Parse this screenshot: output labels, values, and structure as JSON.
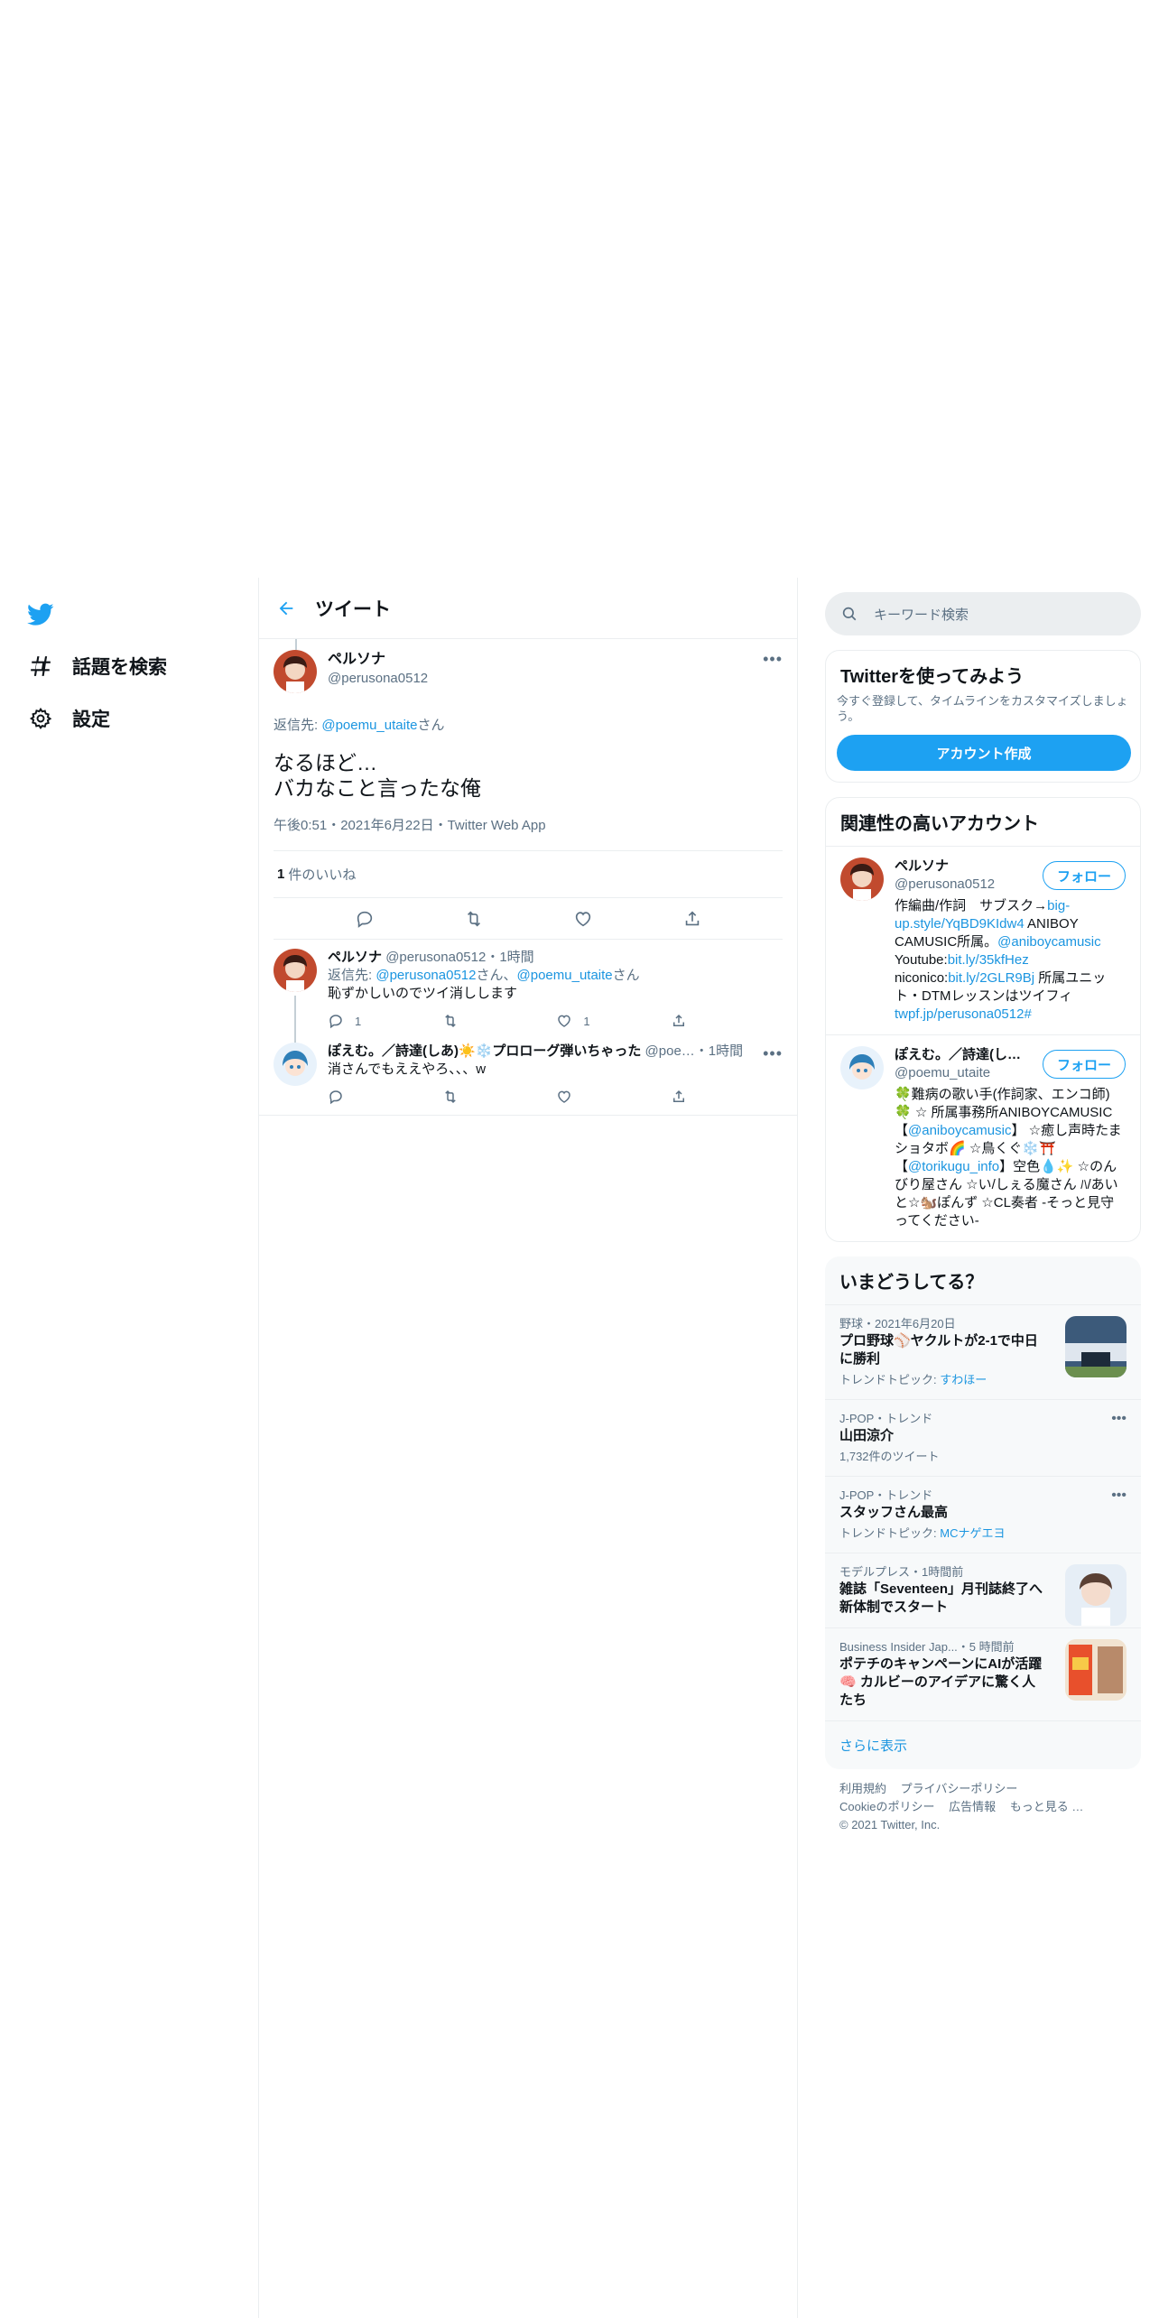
{
  "nav": {
    "items": [
      {
        "label": "話題を検索",
        "icon": "hashtag-icon"
      },
      {
        "label": "設定",
        "icon": "gear-icon"
      }
    ]
  },
  "header": {
    "title": "ツイート"
  },
  "main_tweet": {
    "name": "ペルソナ",
    "handle": "@perusona0512",
    "reply_prefix": "返信先: ",
    "reply_to": "@poemu_utaite",
    "reply_suffix": "さん",
    "text_line1": "なるほど…",
    "text_line2": "バカなこと言ったな俺",
    "meta": "午後0:51・2021年6月22日・Twitter Web App",
    "likes_count": "1",
    "likes_label": "件のいいね"
  },
  "replies": [
    {
      "name": "ペルソナ",
      "handle": "@perusona0512",
      "time": "・1時間",
      "reply_prefix": "返信先: ",
      "reply_to1": "@perusona0512",
      "reply_mid": "さん、",
      "reply_to2": "@poemu_utaite",
      "reply_suffix": "さん",
      "text": "恥ずかしいのでツイ消しします",
      "reply_count": "1",
      "retweet_count": "",
      "like_count": "1"
    },
    {
      "name": "ぽえむ。／詩達(しあ)☀️❄️プロローグ弾いちゃった",
      "handle": "@poe…",
      "time": "・1時間",
      "text": "消さんでもええやろ、、、w",
      "reply_count": "",
      "retweet_count": "",
      "like_count": ""
    }
  ],
  "search": {
    "placeholder": "キーワード検索"
  },
  "signup": {
    "title": "Twitterを使ってみよう",
    "desc": "今すぐ登録して、タイムラインをカスタマイズしましょう。",
    "button": "アカウント作成"
  },
  "related": {
    "title": "関連性の高いアカウント",
    "follow_label": "フォロー",
    "accounts": [
      {
        "name": "ペルソナ",
        "handle": "@perusona0512",
        "bio_1": "作編曲/作詞　サブスク→",
        "bio_link1": "big-up.style/YqBD9KIdw4",
        "bio_2": " ANIBOY CAMUSIC所属。",
        "bio_link2": "@aniboycamusic",
        "bio_3": " Youtube:",
        "bio_link3": "bit.ly/35kfHez",
        "bio_4": " niconico:",
        "bio_link4": "bit.ly/2GLR9Bj",
        "bio_5": " 所属ユニット・DTMレッスンはツイフィ ",
        "bio_link5": "twpf.jp/perusona0512#"
      },
      {
        "name": "ぽえむ。／詩達(しあ)☀️❄️",
        "handle": "@poemu_utaite",
        "bio_1": "🍀難病の歌い手(作詞家、エンコ師)🍀 ☆ 所属事務所ANIBOYCAMUSIC【",
        "bio_link1": "@aniboycamusic",
        "bio_2": "】 ☆癒し声時たまショタボ🌈 ☆鳥くぐ❄️⛩️【",
        "bio_link2": "@torikugu_info",
        "bio_3": "】空色💧✨ ☆のんびり屋さん ☆い/しぇる魔さん ﾊ/あいと☆🐿️ぽんず ☆CL奏者 -そっと見守ってください-"
      }
    ]
  },
  "trends": {
    "title": "いまどうしてる？",
    "items": [
      {
        "meta": "野球・2021年6月20日",
        "title": "プロ野球⚾ヤクルトが2-1で中日に勝利",
        "sub_prefix": "トレンドトピック: ",
        "sub_link": "すわほー",
        "thumb": true
      },
      {
        "meta": "J-POP・トレンド",
        "title": "山田涼介",
        "sub_prefix": "1,732件のツイート",
        "sub_link": "",
        "thumb": false
      },
      {
        "meta": "J-POP・トレンド",
        "title": "スタッフさん最高",
        "sub_prefix": "トレンドトピック: ",
        "sub_link": "MCナゲエヨ",
        "thumb": false
      },
      {
        "meta": "モデルプレス・1時間前",
        "title": "雑誌「Seventeen」月刊誌終了へ 新体制でスタート",
        "sub_prefix": "",
        "sub_link": "",
        "thumb": true
      },
      {
        "meta": "Business Insider Jap...・5 時間前",
        "title": "ポテチのキャンペーンにAIが活躍🧠 カルビーのアイデアに驚く人たち",
        "sub_prefix": "",
        "sub_link": "",
        "thumb": true
      }
    ],
    "show_more": "さらに表示"
  },
  "footer": {
    "links": [
      "利用規約",
      "プライバシーポリシー",
      "Cookieのポリシー",
      "広告情報",
      "もっと見る …"
    ],
    "copyright": "© 2021 Twitter, Inc."
  },
  "colors": {
    "accent": "#1da1f2",
    "link": "#1b95e0",
    "muted": "#5b7083",
    "border": "#ebeef0"
  }
}
